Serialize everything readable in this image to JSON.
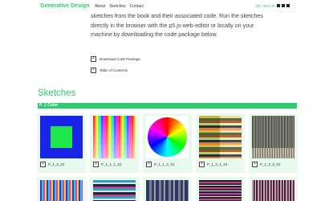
{
  "header": {
    "brand": "Generative Design",
    "nav": [
      "About",
      "Sketches",
      "Contact"
    ],
    "lang": {
      "de": "DE",
      "en": "EN",
      "jp": "JP"
    }
  },
  "intro": {
    "text": "sketches from the book and their associated code. Run the sketches directly in the browser with the p5.js-web-editor or locally on your machine by downloading the code package below."
  },
  "links": {
    "download": "Download Code Package",
    "toc": "Table of Contents"
  },
  "sketches": {
    "title": "Sketches",
    "category": "P_1 Color",
    "cards": [
      {
        "label": "P_1_0_01"
      },
      {
        "label": "P_1_1_1_01"
      },
      {
        "label": "P_1_1_2_01"
      },
      {
        "label": "P_1_2_1_01"
      },
      {
        "label": "P_1_2_2_01"
      }
    ]
  },
  "colors": {
    "accent": "#2ecc71",
    "card_bg": "#e8f9ee"
  }
}
